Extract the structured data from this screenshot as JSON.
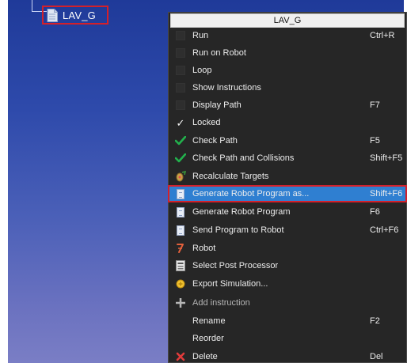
{
  "tree": {
    "item_label": "LAV_G"
  },
  "menu": {
    "title": "LAV_G",
    "items": [
      {
        "label": "Run",
        "shortcut": "Ctrl+R"
      },
      {
        "label": "Run on Robot",
        "shortcut": ""
      },
      {
        "label": "Loop",
        "shortcut": ""
      },
      {
        "label": "Show Instructions",
        "shortcut": ""
      },
      {
        "label": "Display Path",
        "shortcut": "F7"
      },
      {
        "label": "Locked",
        "shortcut": "",
        "check_glyph": "✓"
      },
      {
        "label": "Check Path",
        "shortcut": "F5"
      },
      {
        "label": "Check Path and Collisions",
        "shortcut": "Shift+F5"
      },
      {
        "label": "Recalculate Targets",
        "shortcut": ""
      },
      {
        "label": "Generate Robot Program as...",
        "shortcut": "Shift+F6"
      },
      {
        "label": "Generate Robot Program",
        "shortcut": "F6"
      },
      {
        "label": "Send Program to Robot",
        "shortcut": "Ctrl+F6"
      },
      {
        "label": "Robot",
        "shortcut": ""
      },
      {
        "label": "Select Post Processor",
        "shortcut": ""
      },
      {
        "label": "Export Simulation...",
        "shortcut": ""
      },
      {
        "label": "Add instruction",
        "shortcut": ""
      },
      {
        "label": "Rename",
        "shortcut": "F2"
      },
      {
        "label": "Reorder",
        "shortcut": ""
      },
      {
        "label": "Delete",
        "shortcut": "Del"
      }
    ]
  },
  "icons": {
    "tree_item": "program-document-icon",
    "run": "empty-checkbox-icon",
    "run_on_robot": "empty-checkbox-icon",
    "loop": "empty-checkbox-icon",
    "show_instructions": "empty-checkbox-icon",
    "display_path": "empty-checkbox-icon",
    "locked": "checkmark-icon",
    "check_path": "green-check-icon",
    "check_path_collisions": "green-check-icon",
    "recalculate_targets": "target-icon",
    "generate_program_as": "document-icon",
    "generate_program": "document-icon",
    "send_program": "document-icon",
    "robot": "robot-icon",
    "select_post_processor": "post-processor-icon",
    "export_simulation": "export-icon",
    "add_instruction": "plus-icon",
    "delete": "delete-icon"
  },
  "colors": {
    "menu_bg": "#262626",
    "highlight": "#2f7fd1",
    "annotation_red": "#d4202a",
    "check_green": "#22b14c",
    "delete_red": "#e23b3b"
  }
}
